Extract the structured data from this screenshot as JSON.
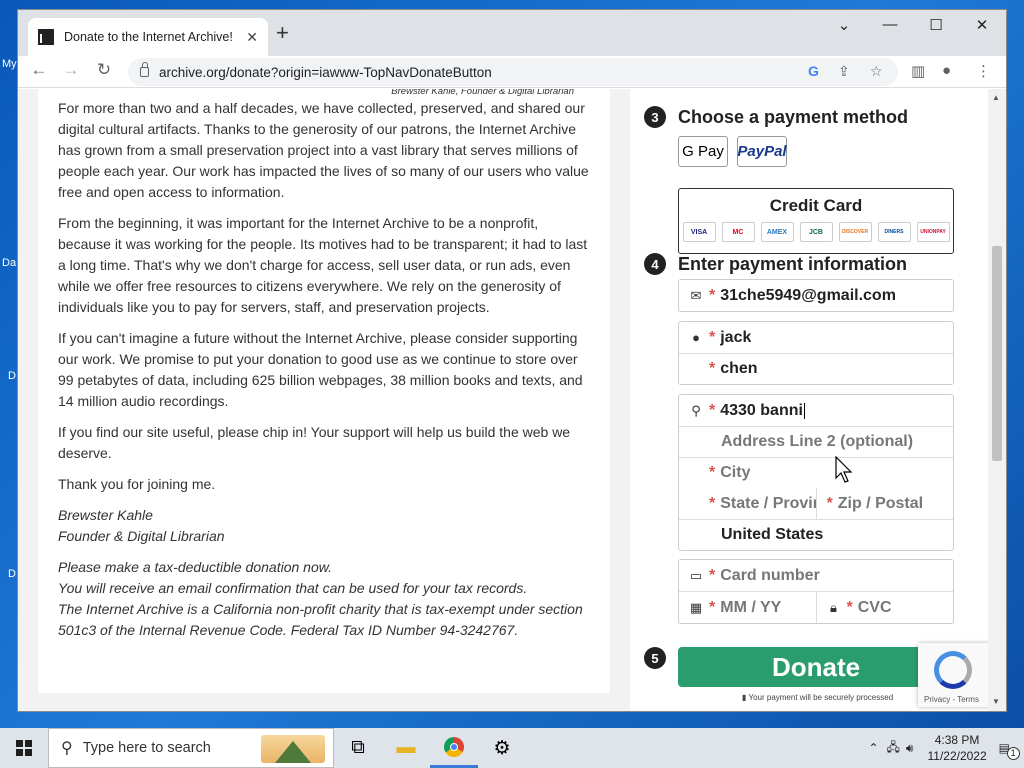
{
  "desktop": {
    "icon_labels": [
      "My",
      "Da",
      "D",
      "D"
    ]
  },
  "browser": {
    "tab_title": "Donate to the Internet Archive!",
    "url": "archive.org/donate?origin=iawww-TopNavDonateButton",
    "newtab_glyph": "+",
    "back_glyph": "←",
    "forward_glyph": "→",
    "reload_glyph": "↻",
    "minimize_glyph": "—",
    "maximize_glyph": "☐",
    "close_glyph": "✕",
    "tabs_menu_glyph": "⌄"
  },
  "letter": {
    "caption": "Brewster Kahle, Founder & Digital Librarian",
    "p1": "For more than two and a half decades, we have collected, preserved, and shared our digital cultural artifacts. Thanks to the generosity of our patrons, the Internet Archive has grown from a small preservation project into a vast library that serves millions of people each year. Our work has impacted the lives of so many of our users who value free and open access to information.",
    "p2": "From the beginning, it was important for the Internet Archive to be a nonprofit, because it was working for the people. Its motives had to be transparent; it had to last a long time. That's why we don't charge for access, sell user data, or run ads, even while we offer free resources to citizens everywhere. We rely on the generosity of individuals like you to pay for servers, staff, and preservation projects.",
    "p3": "If you can't imagine a future without the Internet Archive, please consider supporting our work. We promise to put your donation to good use as we continue to store over 99 petabytes of data, including 625 billion webpages, 38 million books and texts, and 14 million audio recordings.",
    "p4": "If you find our site useful, please chip in! Your support will help us build the web we deserve.",
    "p5": "Thank you for joining me.",
    "sig_name": "Brewster Kahle",
    "sig_title": "Founder & Digital Librarian",
    "note1": "Please make a tax-deductible donation now.",
    "note2": "You will receive an email confirmation that can be used for your tax records.",
    "note3": "The Internet Archive is a California non-profit charity that is tax-exempt under section 501c3 of the Internal Revenue Code. Federal Tax ID Number 94-3242767."
  },
  "form": {
    "step3_num": "3",
    "step3_label": "Choose a payment method",
    "gpay_label": "G Pay",
    "paypal_label": "PayPal",
    "cc_title": "Credit Card",
    "cards": [
      "VISA",
      "MC",
      "AMEX",
      "JCB",
      "DISCOVER",
      "DINERS",
      "UNIONPAY"
    ],
    "step4_num": "4",
    "step4_label": "Enter payment information",
    "required_mark": "*",
    "email": "31che5949@gmail.com",
    "first_name": "jack",
    "last_name": "chen",
    "address1": "4330 banni",
    "address2_ph": "Address Line 2 (optional)",
    "city_ph": "City",
    "state_ph": "State / Province",
    "zip_ph": "Zip / Postal",
    "country": "United States",
    "card_ph": "Card number",
    "exp_ph": "MM / YY",
    "cvc_ph": "CVC",
    "step5_num": "5",
    "donate_label": "Donate",
    "secure_text": "Your payment will be securely processed",
    "recaptcha_text": "Privacy - Terms"
  },
  "taskbar": {
    "search_text": "Type here to search",
    "time": "4:38 PM",
    "date": "11/22/2022",
    "notif_count": "1"
  },
  "colors": {
    "donate_green": "#2a9d6f",
    "required_red": "#d9534f",
    "taskbar_bg": "#dfe3ea"
  }
}
